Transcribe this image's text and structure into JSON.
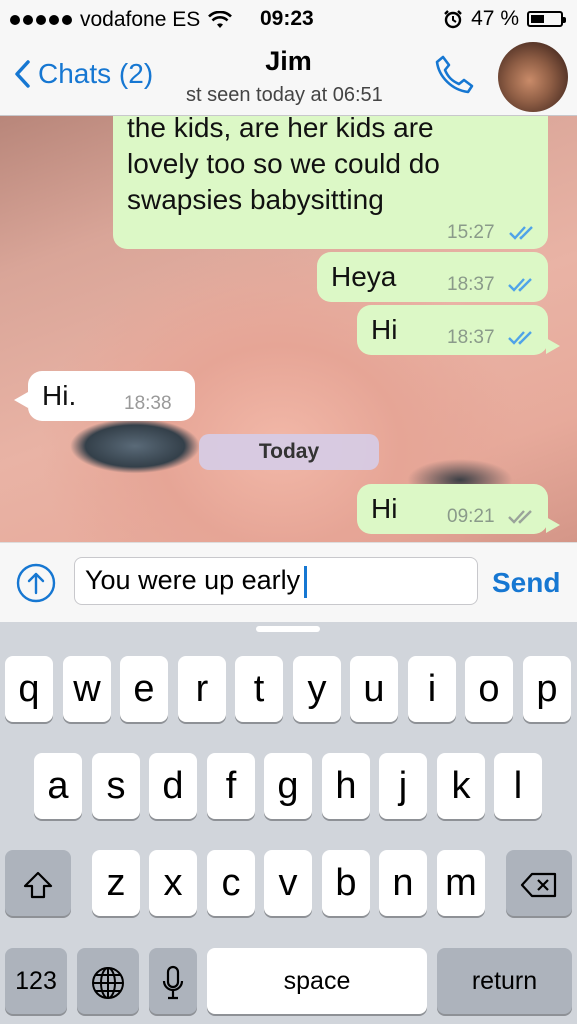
{
  "status_bar": {
    "carrier": "vodafone ES",
    "time": "09:23",
    "battery_text": "47 %",
    "battery_fraction": 0.47
  },
  "nav": {
    "back_label": "Chats (2)",
    "title": "Jim",
    "subtitle": "st seen today at 06:51"
  },
  "messages": [
    {
      "lines": [
        "the kids, are her kids are",
        "lovely too so we could do",
        "swapsies babysitting"
      ],
      "time": "15:27",
      "dir": "out",
      "read": true
    },
    {
      "text": "Heya",
      "time": "18:37",
      "dir": "out",
      "read": true
    },
    {
      "text": "Hi",
      "time": "18:37",
      "dir": "out",
      "read": true
    },
    {
      "text": "Hi.",
      "time": "18:38",
      "dir": "in"
    },
    {
      "text": "Hi",
      "time": "09:21",
      "dir": "out",
      "read": false
    }
  ],
  "day_separator": "Today",
  "composer": {
    "input_value": "You were up early",
    "send_label": "Send"
  },
  "keyboard": {
    "row1": [
      "q",
      "w",
      "e",
      "r",
      "t",
      "y",
      "u",
      "i",
      "o",
      "p"
    ],
    "row2": [
      "a",
      "s",
      "d",
      "f",
      "g",
      "h",
      "j",
      "k",
      "l"
    ],
    "row3": [
      "z",
      "x",
      "c",
      "v",
      "b",
      "n",
      "m"
    ],
    "numbers_label": "123",
    "space_label": "space",
    "return_label": "return"
  },
  "colors": {
    "accent": "#1677d2",
    "outgoing_bubble": "#dcf8c6",
    "incoming_bubble": "#ffffff",
    "read_tick": "#4fa3e8",
    "delivered_tick": "#9aa39a"
  }
}
